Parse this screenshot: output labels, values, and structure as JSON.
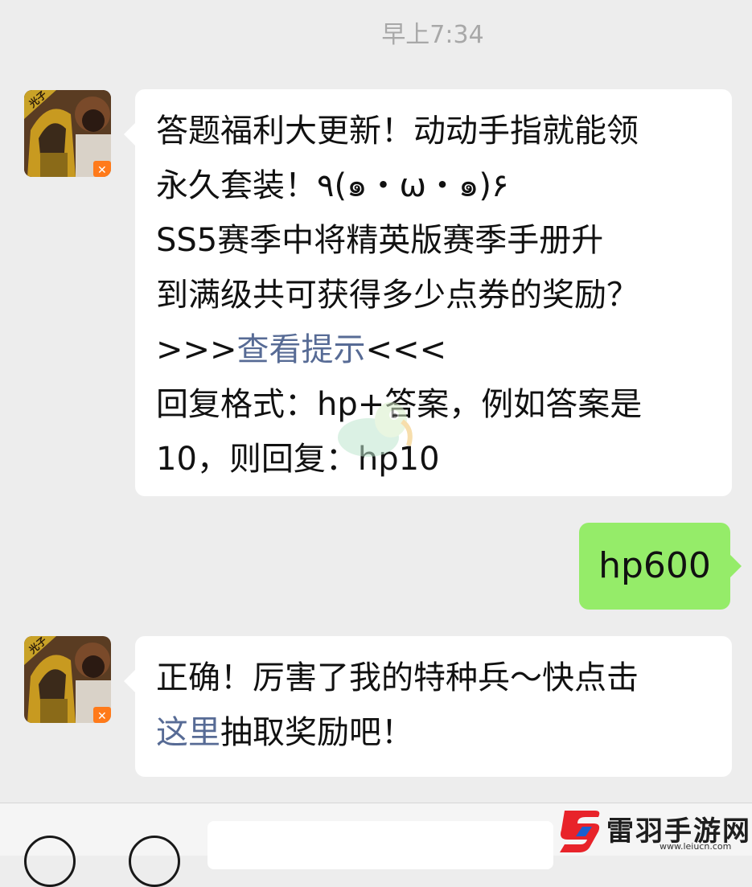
{
  "timestamp": "早上7:34",
  "messages": [
    {
      "lines": [
        "答题福利大更新！动动手指就能领",
        "永久套装！٩(๑・ω・๑)۶",
        "SS5赛季中将精英版赛季手册升",
        "到满级共可获得多少点券的奖励？"
      ],
      "hint_prefix": ">>>",
      "hint_link": "查看提示",
      "hint_suffix": "<<<",
      "reply_lines": [
        "回复格式：hp+答案，例如答案是",
        "10，则回复：hp10"
      ]
    },
    {
      "text": "hp600"
    },
    {
      "line1": "正确！厉害了我的特种兵～快点击",
      "link": "这里",
      "line2_rest": "抽取奖励吧！"
    }
  ],
  "avatar_badge": "光子",
  "watermark": {
    "name": "雷羽手游网",
    "url": "www.leiucn.com"
  },
  "colors": {
    "background": "#ededed",
    "bubble_in": "#ffffff",
    "bubble_out": "#95ec69",
    "link": "#576b95"
  }
}
